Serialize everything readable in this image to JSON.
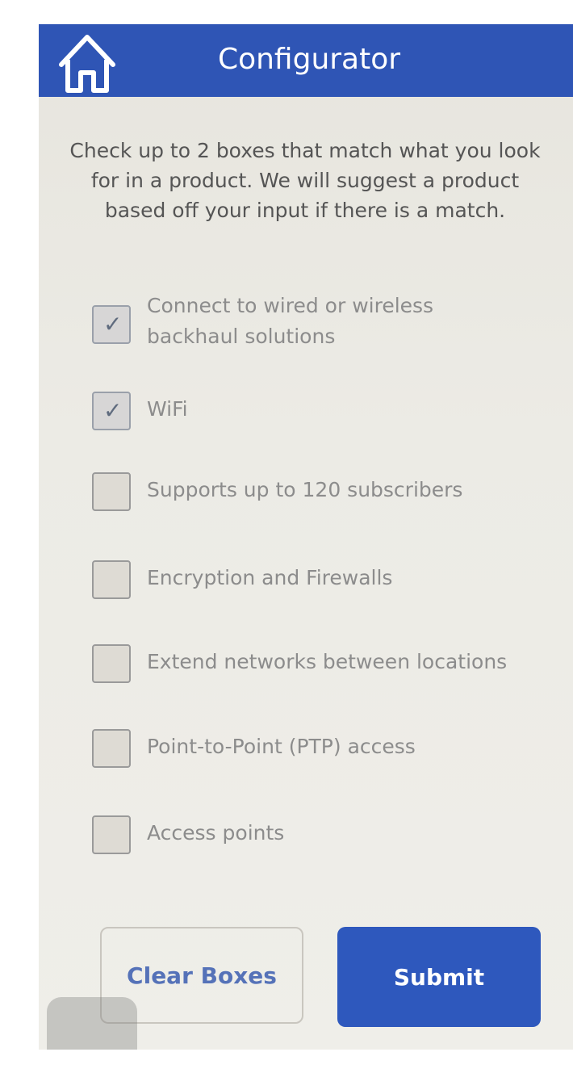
{
  "header": {
    "title": "Configurator",
    "home_icon": "home-icon",
    "background_color": "#2f55b5"
  },
  "instructions": "Check up to 2 boxes that match what you look for in a product. We will suggest a product based off your input if there is a match.",
  "options": [
    {
      "label": "Connect to wired or wireless backhaul solutions",
      "checked": true
    },
    {
      "label": "WiFi",
      "checked": true
    },
    {
      "label": "Supports up to 120 subscribers",
      "checked": false
    },
    {
      "label": "Encryption and Firewalls",
      "checked": false
    },
    {
      "label": "Extend networks between locations",
      "checked": false
    },
    {
      "label": "Point-to-Point (PTP) access",
      "checked": false
    },
    {
      "label": "Access points",
      "checked": false
    }
  ],
  "buttons": {
    "clear_label": "Clear Boxes",
    "submit_label": "Submit",
    "submit_color": "#2e58bd"
  }
}
